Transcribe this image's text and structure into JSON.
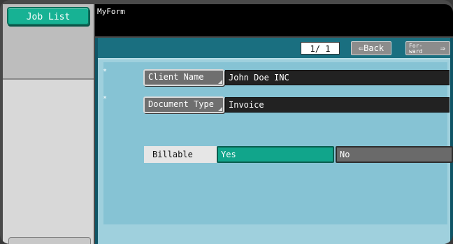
{
  "left_panel": {
    "job_list_label": "Job List"
  },
  "header": {
    "title": "MyForm"
  },
  "nav": {
    "page_indicator": "1/ 1",
    "back_label": "Back",
    "back_arrow": "⇐",
    "forward_label_line1": "For-",
    "forward_label_line2": "ward",
    "forward_arrow": "⇒"
  },
  "form": {
    "required_marker": "*",
    "fields": [
      {
        "label": "Client Name",
        "value": "John Doe INC"
      },
      {
        "label": "Document Type",
        "value": "Invoice"
      }
    ],
    "billable": {
      "label": "Billable",
      "options": [
        "Yes",
        "No"
      ],
      "selected": "Yes"
    }
  },
  "colors": {
    "accent": "#17b294",
    "selected_option": "#11a58b",
    "frame": "#0f5566",
    "form_bg": "#86c3d4"
  },
  "icons": {
    "back": "left-arrow-icon",
    "forward": "right-arrow-icon"
  }
}
